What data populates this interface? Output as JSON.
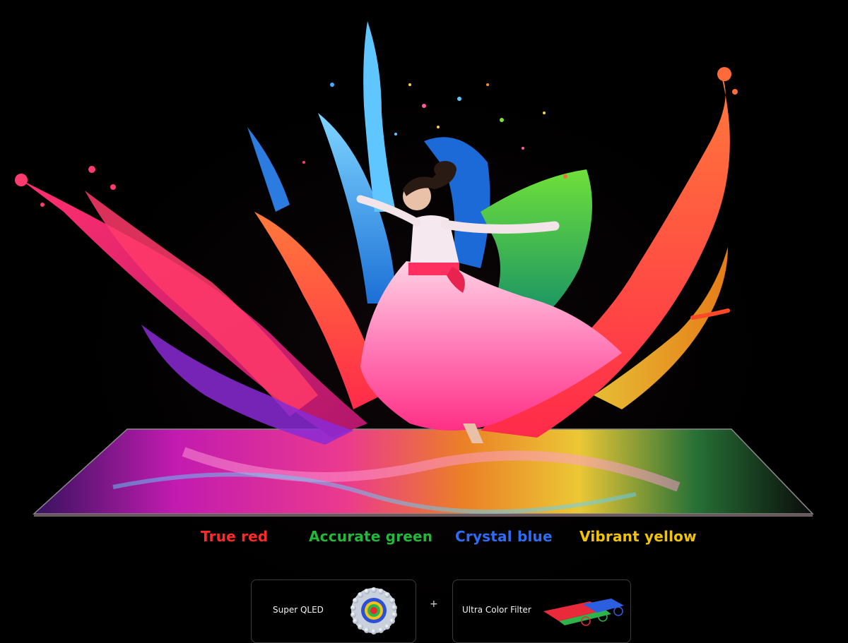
{
  "color_labels": [
    {
      "text": "True red",
      "color": "#ff2a2a"
    },
    {
      "text": "Accurate green",
      "color": "#22b83a"
    },
    {
      "text": "Crystal blue",
      "color": "#2f6cf5"
    },
    {
      "text": "Vibrant yellow",
      "color": "#f2c400"
    }
  ],
  "tech": {
    "qled_label": "Super QLED",
    "plus": "+",
    "filter_label": "Ultra Color Filter"
  },
  "icons": {
    "qled": "quantum-dot-sphere-icon",
    "filter": "color-filter-layers-icon"
  },
  "colors": {
    "background": "#000000",
    "red": "#ff2a2a",
    "green": "#22b83a",
    "blue": "#2f6cf5",
    "yellow": "#f2c400",
    "orange": "#ff6a1a",
    "magenta": "#ff2f8f"
  }
}
